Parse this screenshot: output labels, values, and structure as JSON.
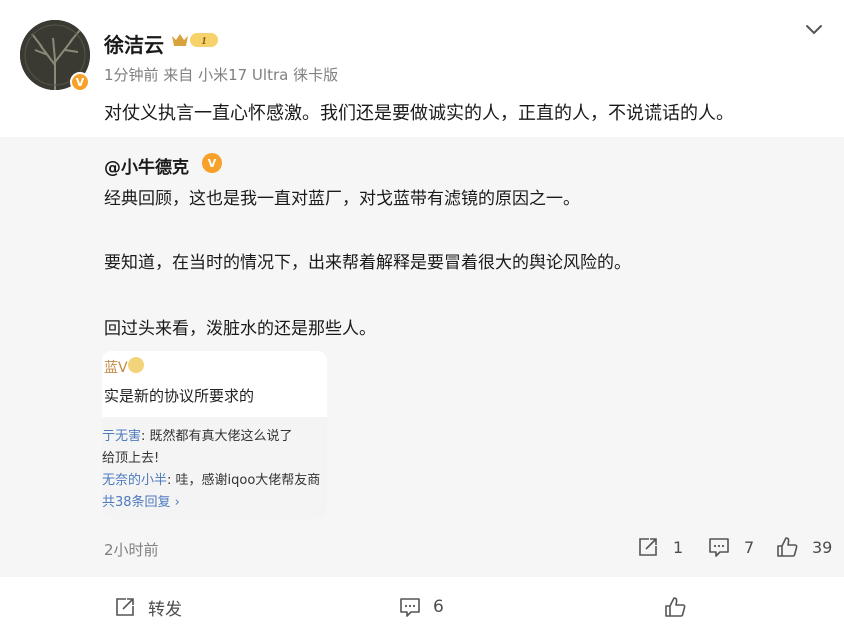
{
  "post": {
    "username": "徐洁云",
    "level": "1",
    "meta": "1分钟前  来自 小米17 Ultra 徕卡版",
    "text": "对仗义执言一直心怀感激。我们还是要做诚实的人，正直的人，不说谎话的人。"
  },
  "quoted": {
    "author": "@小牛德克",
    "line1": "经典回顾，这也是我一直对蓝厂，对戈蓝带有滤镜的原因之一。",
    "line2": "要知道，在当时的情况下，出来帮着解释是要冒着很大的舆论风险的。",
    "line3": "回过头来看，泼脏水的还是那些人。",
    "embed": {
      "title": "蓝V",
      "main": "实是新的协议所要求的",
      "comment1_name": "亍无害",
      "comment1_text": ": 既然都有真大佬这么说了",
      "comment1_cont": "给顶上去!",
      "comment2_name": "无奈的小半",
      "comment2_text": ": 哇，感谢iqoo大佬帮友商",
      "more": "共38条回复 ›"
    },
    "time": "2小时前",
    "repost_count": "1",
    "comment_count": "7",
    "like_count": "39"
  },
  "bottom": {
    "repost_label": "转发",
    "comment_count": "6"
  },
  "colors": {
    "accent_orange": "#f7a12a",
    "link_blue": "#4e7bbd",
    "quote_bg": "#f6f6f6"
  },
  "icons": {
    "repost": "repost-icon",
    "comment": "comment-icon",
    "like": "thumbs-up-icon",
    "expand": "chevron-down-icon"
  }
}
